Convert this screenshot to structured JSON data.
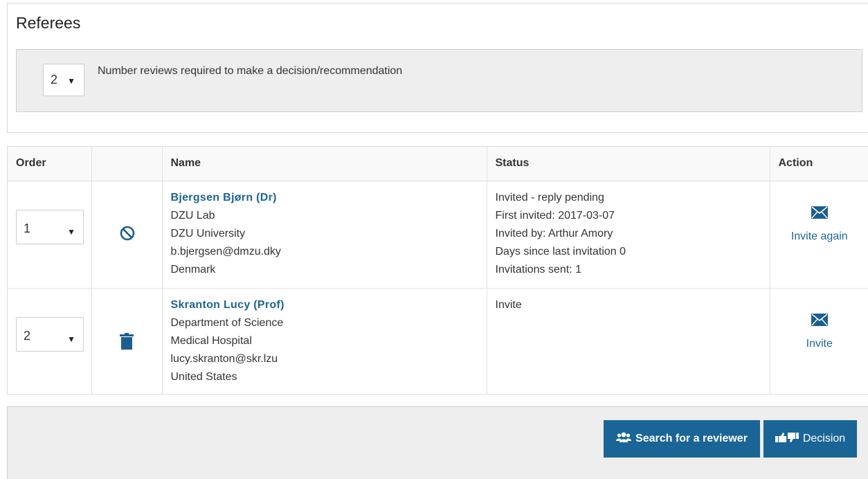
{
  "panel": {
    "title": "Referees",
    "required_reviews": {
      "value": "2",
      "label": "Number reviews required to make a decision/recommendation"
    }
  },
  "table": {
    "headers": {
      "order": "Order",
      "icon": "",
      "name": "Name",
      "status": "Status",
      "action": "Action"
    },
    "rows": [
      {
        "order": "1",
        "icon": "ban-icon",
        "name": "Bjergsen Bjørn (Dr)",
        "details": [
          "DZU Lab",
          "DZU University",
          "b.bjergsen@dmzu.dky",
          "Denmark"
        ],
        "status": [
          "Invited - reply pending",
          "First invited: 2017-03-07",
          "Invited by: Arthur Amory",
          "Days since last invitation 0",
          "Invitations sent: 1"
        ],
        "action": "Invite again"
      },
      {
        "order": "2",
        "icon": "trash-icon",
        "name": "Skranton Lucy (Prof)",
        "details": [
          "Department of Science",
          "Medical Hospital",
          "lucy.skranton@skr.lzu",
          "United States"
        ],
        "status": [
          "Invite"
        ],
        "action": "Invite"
      }
    ]
  },
  "footer": {
    "search_label": "Search for a reviewer",
    "decision_label": "Decision"
  },
  "colors": {
    "accent": "#1a6596",
    "link": "#1c6597",
    "well": "#eeeeee"
  }
}
